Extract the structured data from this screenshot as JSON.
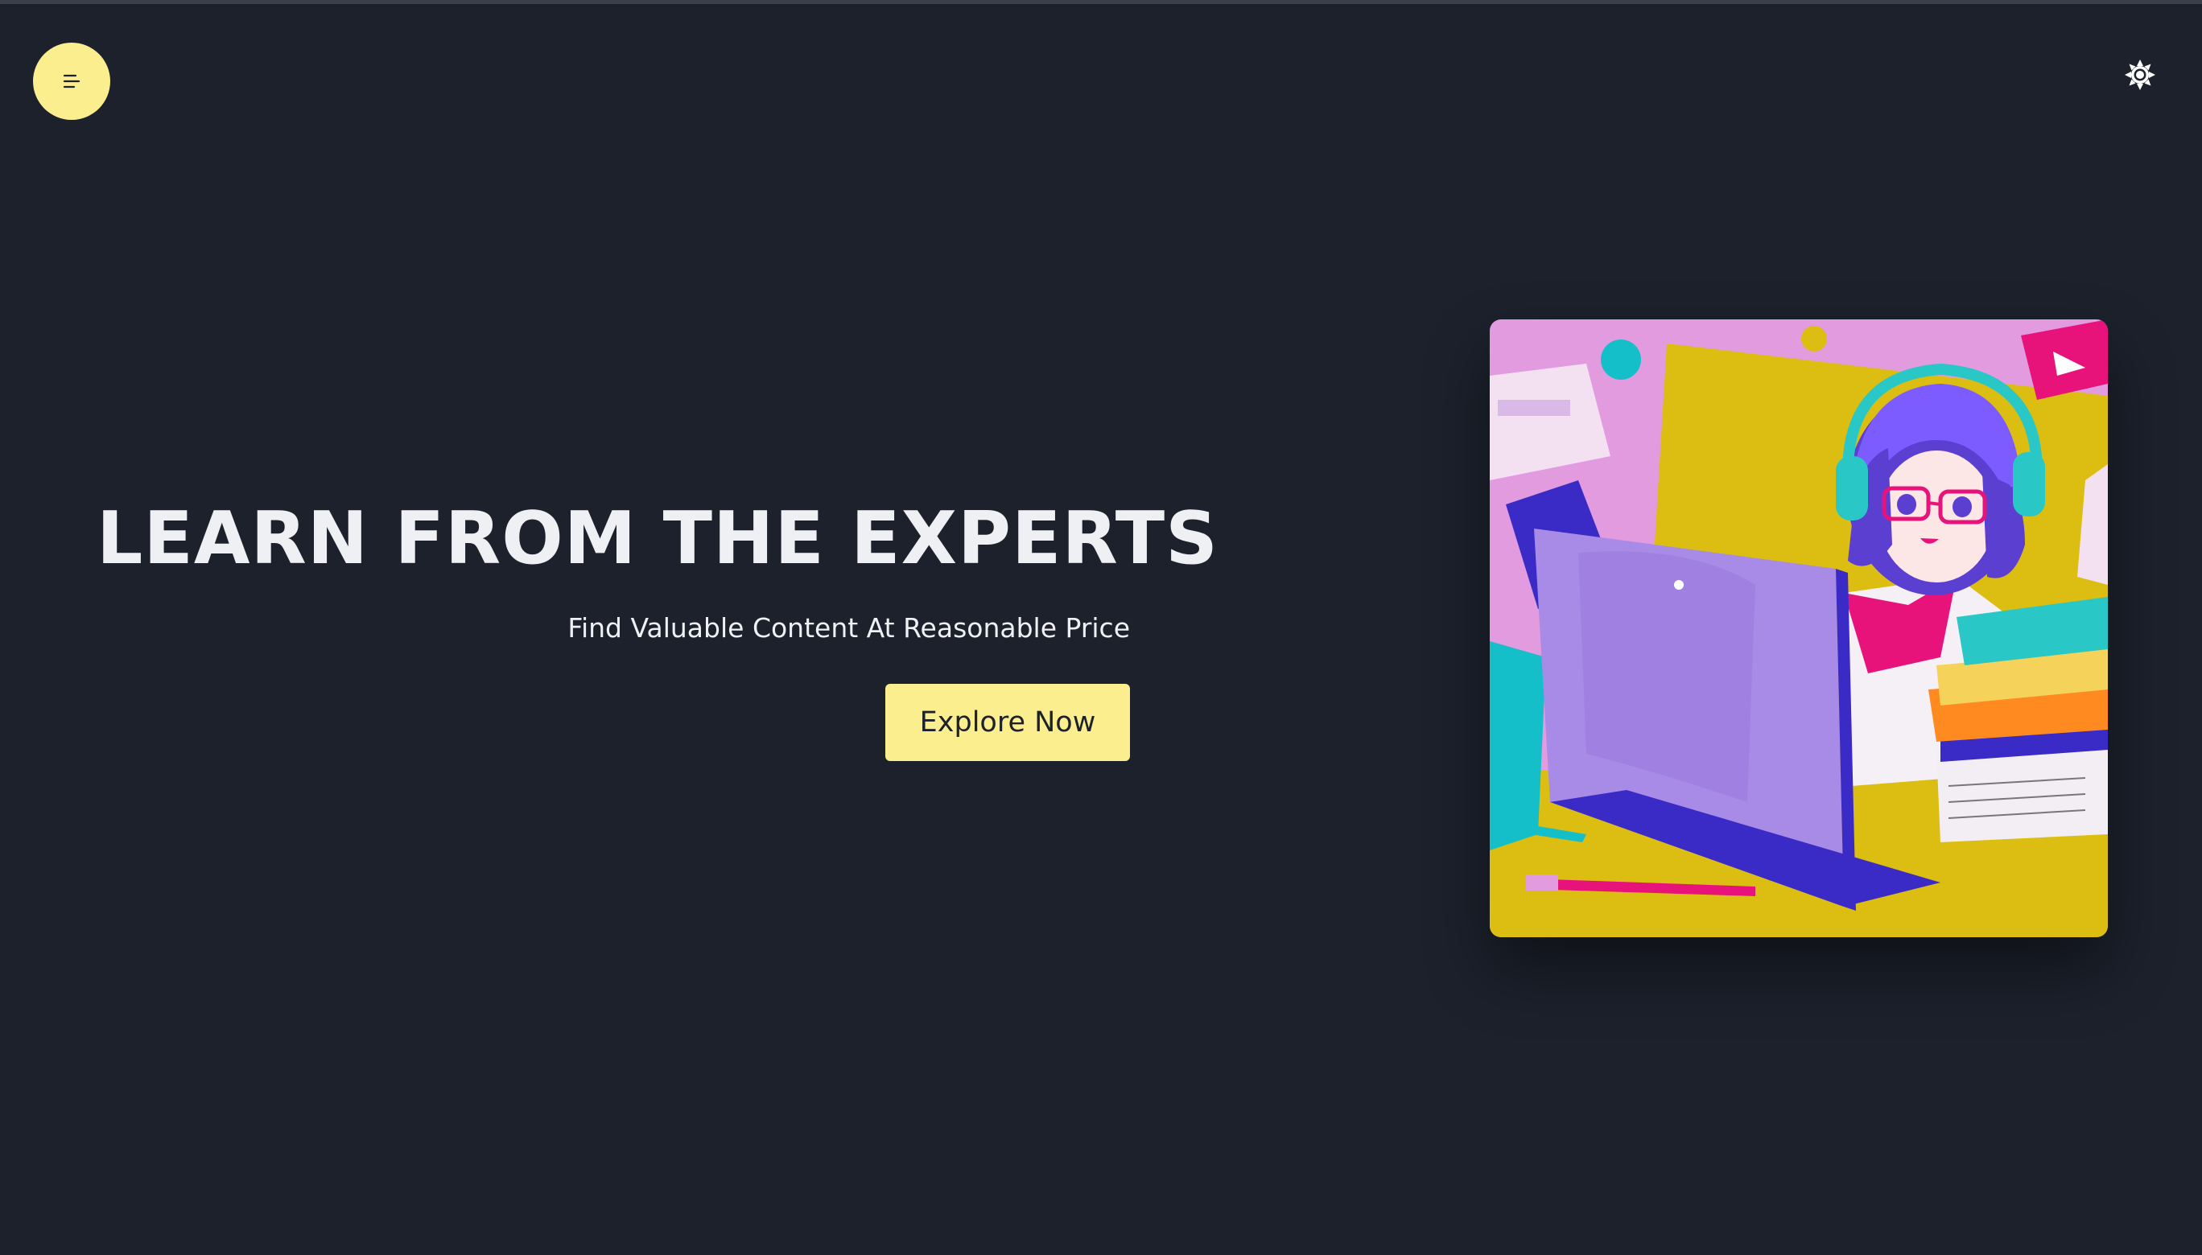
{
  "header": {
    "menu_icon": "hamburger-menu-icon",
    "theme_icon": "sun-icon"
  },
  "hero": {
    "title": "LEARN FROM THE EXPERTS",
    "subtitle": "Find Valuable Content At Reasonable Price",
    "cta_label": "Explore Now",
    "illustration": "anime-girl-laptop-illustration"
  },
  "colors": {
    "background": "#1c212c",
    "accent": "#fbee8e",
    "text": "#eef0f3"
  }
}
